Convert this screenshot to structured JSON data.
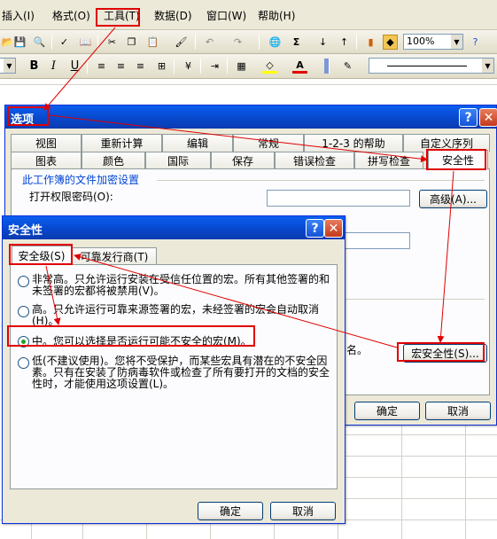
{
  "menubar": {
    "items": [
      {
        "label": "插入(I)",
        "key": "insert"
      },
      {
        "label": "格式(O)",
        "key": "format"
      },
      {
        "label": "工具(T)",
        "key": "tools"
      },
      {
        "label": "数据(D)",
        "key": "data"
      },
      {
        "label": "窗口(W)",
        "key": "window"
      },
      {
        "label": "帮助(H)",
        "key": "help"
      }
    ]
  },
  "toolbar": {
    "zoom": "100%",
    "sigma": "Σ"
  },
  "format_toolbar": {
    "bold": "B",
    "italic": "I",
    "underline": "U",
    "font_color": "A"
  },
  "options_dialog": {
    "title": "选项",
    "tabs_row1": [
      "视图",
      "重新计算",
      "编辑",
      "常规",
      "1-2-3 的帮助",
      "自定义序列"
    ],
    "tabs_row2": [
      "图表",
      "颜色",
      "国际",
      "保存",
      "错误检查",
      "拼写检查",
      "安全性"
    ],
    "group_label": "此工作簿的文件加密设置",
    "open_password_label": "打开权限密码(O):",
    "advanced_button": "高级(A)...",
    "macro_section_text": "名。",
    "macro_security_button": "宏安全性(S)...",
    "ok": "确定",
    "cancel": "取消"
  },
  "security_dialog": {
    "title": "安全性",
    "tabs": [
      "安全级(S)",
      "可靠发行商(T)"
    ],
    "options": [
      {
        "text": "非常高。只允许运行安装在受信任位置的宏。所有其他签署的和未签署的宏都将被禁用(V)。",
        "selected": false
      },
      {
        "text": "高。只允许运行可靠来源签署的宏，未经签署的宏会自动取消(H)。",
        "selected": false
      },
      {
        "text": "中。您可以选择是否运行可能不安全的宏(M)。",
        "selected": true
      },
      {
        "text": "低(不建议使用)。您将不受保护，而某些宏具有潜在的不安全因素。只有在安装了防病毒软件或检查了所有要打开的文档的安全性时，才能使用这项设置(L)。",
        "selected": false
      }
    ],
    "ok": "确定",
    "cancel": "取消"
  }
}
